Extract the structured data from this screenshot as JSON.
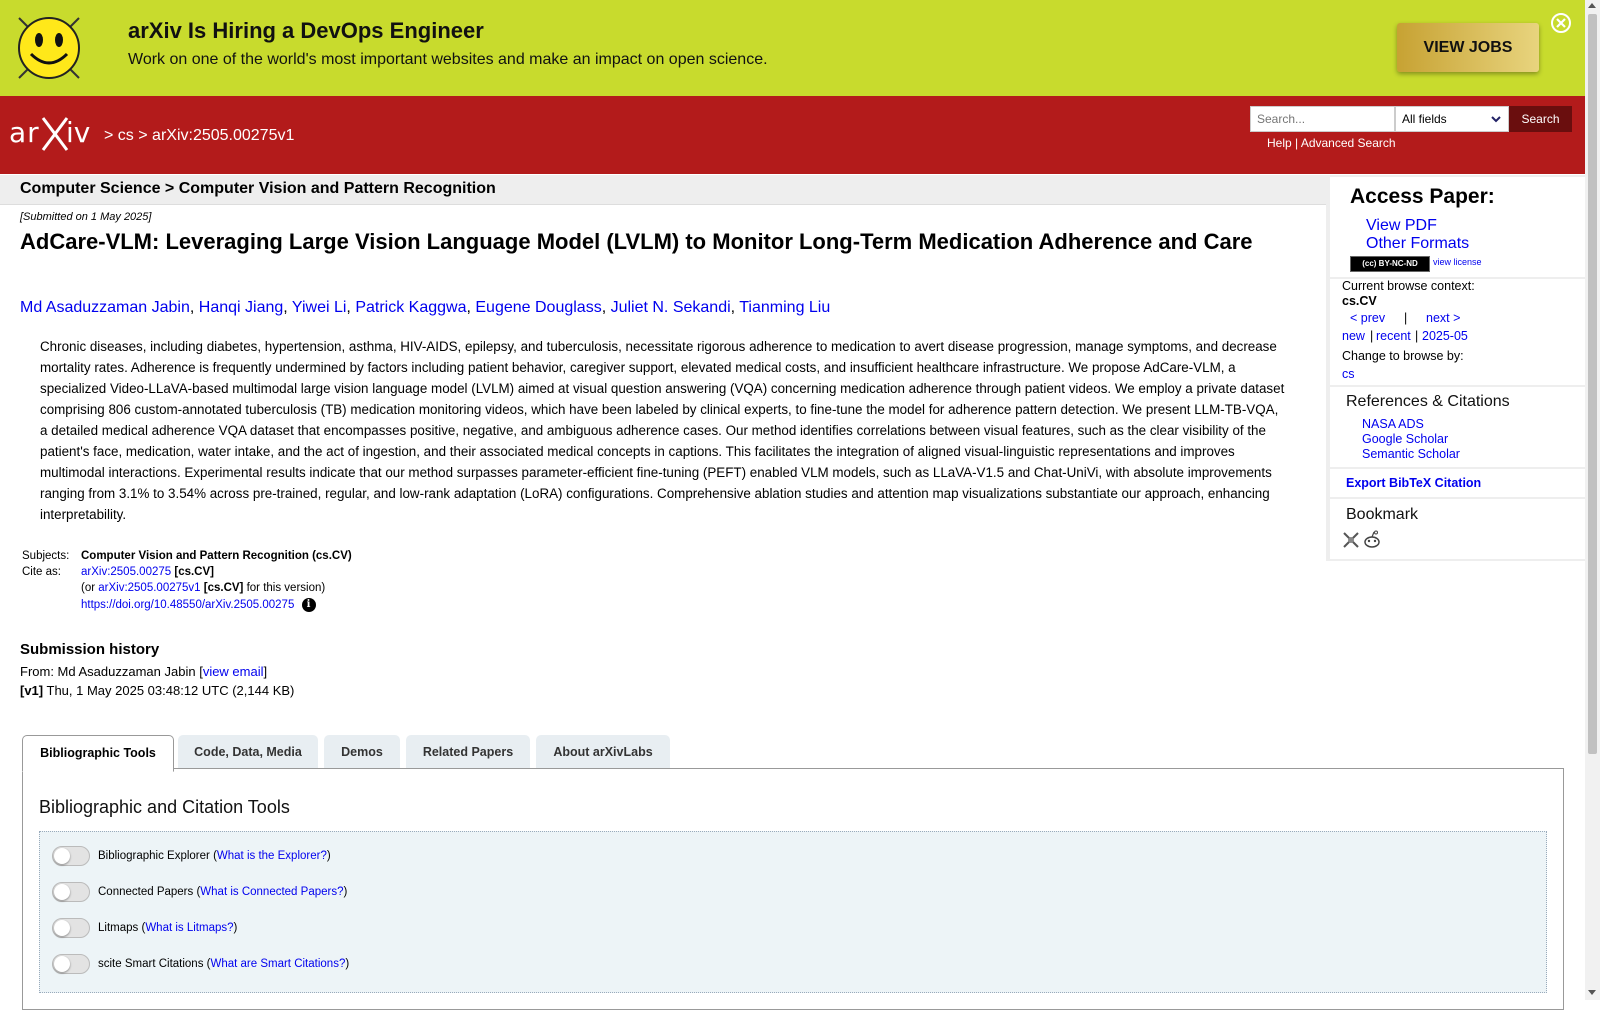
{
  "banner": {
    "title": "arXiv Is Hiring a DevOps Engineer",
    "text": "Work on one of the world's most important websites and make an impact on open science.",
    "button": "VIEW JOBS"
  },
  "header": {
    "logo_text": "arXiv",
    "crumb_sep1": ">",
    "crumb_cs": "cs",
    "crumb_sep2": ">",
    "crumb_id": "arXiv:2505.00275v1",
    "search_placeholder": "Search...",
    "search_field": "All fields",
    "search_button": "Search",
    "help": "Help",
    "pipe": "|",
    "advanced": "Advanced Search"
  },
  "subject_bar": "Computer Science > Computer Vision and Pattern Recognition",
  "paper": {
    "submitted": "[Submitted on 1 May 2025]",
    "title": "AdCare-VLM: Leveraging Large Vision Language Model (LVLM) to Monitor Long-Term Medication Adherence and Care",
    "authors": [
      "Md Asaduzzaman Jabin",
      "Hanqi Jiang",
      "Yiwei Li",
      "Patrick Kaggwa",
      "Eugene Douglass",
      "Juliet N. Sekandi",
      "Tianming Liu"
    ],
    "abstract": "Chronic diseases, including diabetes, hypertension, asthma, HIV-AIDS, epilepsy, and tuberculosis, necessitate rigorous adherence to medication to avert disease progression, manage symptoms, and decrease mortality rates. Adherence is frequently undermined by factors including patient behavior, caregiver support, elevated medical costs, and insufficient healthcare infrastructure. We propose AdCare-VLM, a specialized Video-LLaVA-based multimodal large vision language model (LVLM) aimed at visual question answering (VQA) concerning medication adherence through patient videos. We employ a private dataset comprising 806 custom-annotated tuberculosis (TB) medication monitoring videos, which have been labeled by clinical experts, to fine-tune the model for adherence pattern detection. We present LLM-TB-VQA, a detailed medical adherence VQA dataset that encompasses positive, negative, and ambiguous adherence cases. Our method identifies correlations between visual features, such as the clear visibility of the patient's face, medication, water intake, and the act of ingestion, and their associated medical concepts in captions. This facilitates the integration of aligned visual-linguistic representations and improves multimodal interactions. Experimental results indicate that our method surpasses parameter-efficient fine-tuning (PEFT) enabled VLM models, such as LLaVA-V1.5 and Chat-UniVi, with absolute improvements ranging from 3.1% to 3.54% across pre-trained, regular, and low-rank adaptation (LoRA) configurations. Comprehensive ablation studies and attention map visualizations substantiate our approach, enhancing interpretability.",
    "subjects_label": "Subjects:",
    "subjects_value": "Computer Vision and Pattern Recognition (cs.CV)",
    "cite_label": "Cite as:",
    "cite_id": "arXiv:2505.00275",
    "cite_cat": "[cs.CV]",
    "or_prefix": "(or ",
    "cite_v1": "arXiv:2505.00275v1",
    "cite_v1_cat": "[cs.CV]",
    "for_version": " for this version)",
    "doi": "https://doi.org/10.48550/arXiv.2505.00275",
    "doi_icon": "i"
  },
  "history": {
    "heading": "Submission history",
    "from_prefix": "From: Md Asaduzzaman Jabin [",
    "view_email": "view email",
    "from_suffix": "]",
    "v1_label": "[v1]",
    "v1_text": " Thu, 1 May 2025 03:48:12 UTC (2,144 KB)"
  },
  "tabs": [
    "Bibliographic Tools",
    "Code, Data, Media",
    "Demos",
    "Related Papers",
    "About arXivLabs"
  ],
  "panel": {
    "title": "Bibliographic and Citation Tools",
    "tools": [
      {
        "name": "Bibliographic Explorer",
        "link": "What is the Explorer?"
      },
      {
        "name": "Connected Papers",
        "link": "What is Connected Papers?"
      },
      {
        "name": "Litmaps",
        "link": "What is Litmaps?"
      },
      {
        "name": "scite Smart Citations",
        "link": "What are Smart Citations?"
      }
    ]
  },
  "sidebar": {
    "access_heading": "Access Paper:",
    "view_pdf": "View PDF",
    "other_formats": "Other Formats",
    "license_badge": "(cc) BY-NC-ND",
    "view_license": "view license",
    "context_label": "Current browse context:",
    "context_value": "cs.CV",
    "prev": "< prev",
    "sep": "|",
    "next": "next >",
    "new": "new",
    "recent": "recent",
    "month": "2025-05",
    "change_label": "Change to browse by:",
    "browse_cs": "cs",
    "refs_heading": "References & Citations",
    "nasa": "NASA ADS",
    "google": "Google Scholar",
    "semantic": "Semantic Scholar",
    "export": "Export BibTeX Citation",
    "bookmark": "Bookmark"
  }
}
